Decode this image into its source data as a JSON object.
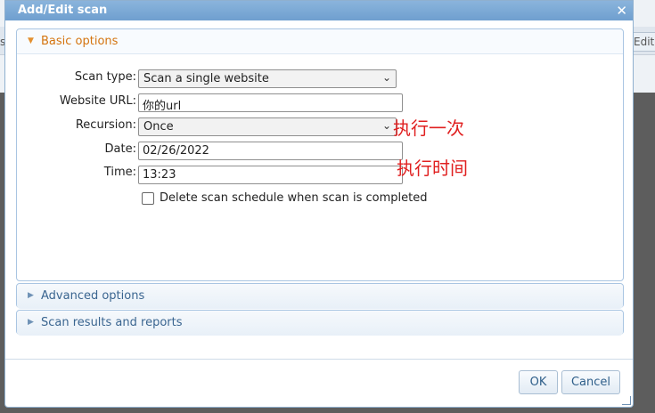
{
  "background": {
    "partial_left_label": "s",
    "partial_edit_button": "Edit"
  },
  "dialog": {
    "title": "Add/Edit scan",
    "close_icon": "close-icon"
  },
  "sections": {
    "basic": {
      "label": "Basic options",
      "expanded": true,
      "arrow_icon": "triangle-down-icon"
    },
    "advanced": {
      "label": "Advanced options",
      "expanded": false,
      "arrow_icon": "triangle-right-icon"
    },
    "results": {
      "label": "Scan results and reports",
      "expanded": false,
      "arrow_icon": "triangle-right-icon"
    }
  },
  "form": {
    "scan_type": {
      "label": "Scan type:",
      "value": "Scan a single website"
    },
    "website_url": {
      "label": "Website URL:",
      "value": "你的url"
    },
    "recursion": {
      "label": "Recursion:",
      "value": "Once"
    },
    "date": {
      "label": "Date:",
      "value": "02/26/2022"
    },
    "time": {
      "label": "Time:",
      "value": "13:23"
    },
    "delete_schedule": {
      "label": "Delete scan schedule when scan is completed",
      "checked": false
    }
  },
  "annotations": {
    "recursion_note": "执行一次",
    "time_note": "执行时间"
  },
  "buttons": {
    "ok": "OK",
    "cancel": "Cancel"
  },
  "colors": {
    "titlebar": "#7aa8d6",
    "section_label_active": "#d4740f",
    "section_label": "#3a6590",
    "annotation": "#e02020"
  }
}
